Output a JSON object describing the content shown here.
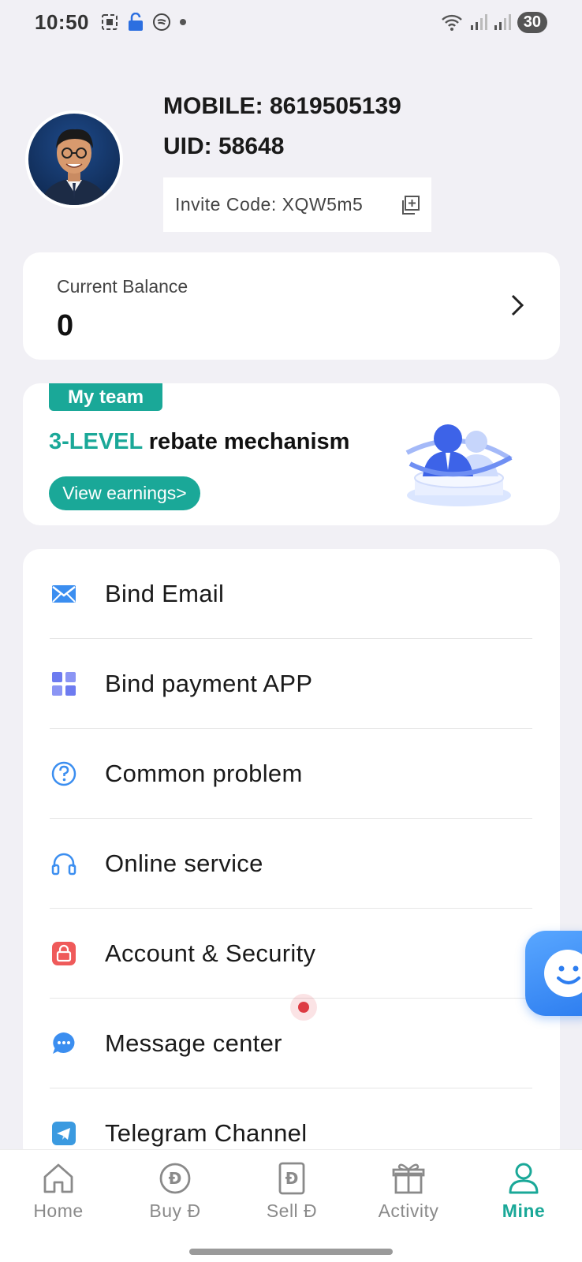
{
  "status_bar": {
    "time": "10:50",
    "battery": "30"
  },
  "profile": {
    "mobile_label": "MOBILE: 8619505139",
    "uid_label": "UID: 58648",
    "invite_label": "Invite Code: XQW5m5"
  },
  "balance": {
    "label": "Current Balance",
    "value": "0"
  },
  "team": {
    "badge": "My team",
    "title_highlight": "3-LEVEL",
    "title_rest": " rebate mechanism",
    "button": "View earnings>"
  },
  "menu": {
    "items": [
      {
        "label": "Bind Email",
        "icon": "mail-icon"
      },
      {
        "label": "Bind payment APP",
        "icon": "grid-icon"
      },
      {
        "label": "Common problem",
        "icon": "question-icon"
      },
      {
        "label": "Online service",
        "icon": "headset-icon"
      },
      {
        "label": "Account & Security",
        "icon": "lock-icon"
      },
      {
        "label": "Message center",
        "icon": "chat-bubble-icon"
      },
      {
        "label": "Telegram Channel",
        "icon": "telegram-icon"
      }
    ]
  },
  "tabs": [
    {
      "label": "Home",
      "icon": "home-icon",
      "active": false
    },
    {
      "label": "Buy Đ",
      "icon": "coin-icon",
      "active": false
    },
    {
      "label": "Sell Đ",
      "icon": "doc-coin-icon",
      "active": false
    },
    {
      "label": "Activity",
      "icon": "gift-icon",
      "active": false
    },
    {
      "label": "Mine",
      "icon": "user-icon",
      "active": true
    }
  ],
  "colors": {
    "accent": "#1aa898",
    "background": "#f1f0f5",
    "notification": "#dd3b43"
  }
}
